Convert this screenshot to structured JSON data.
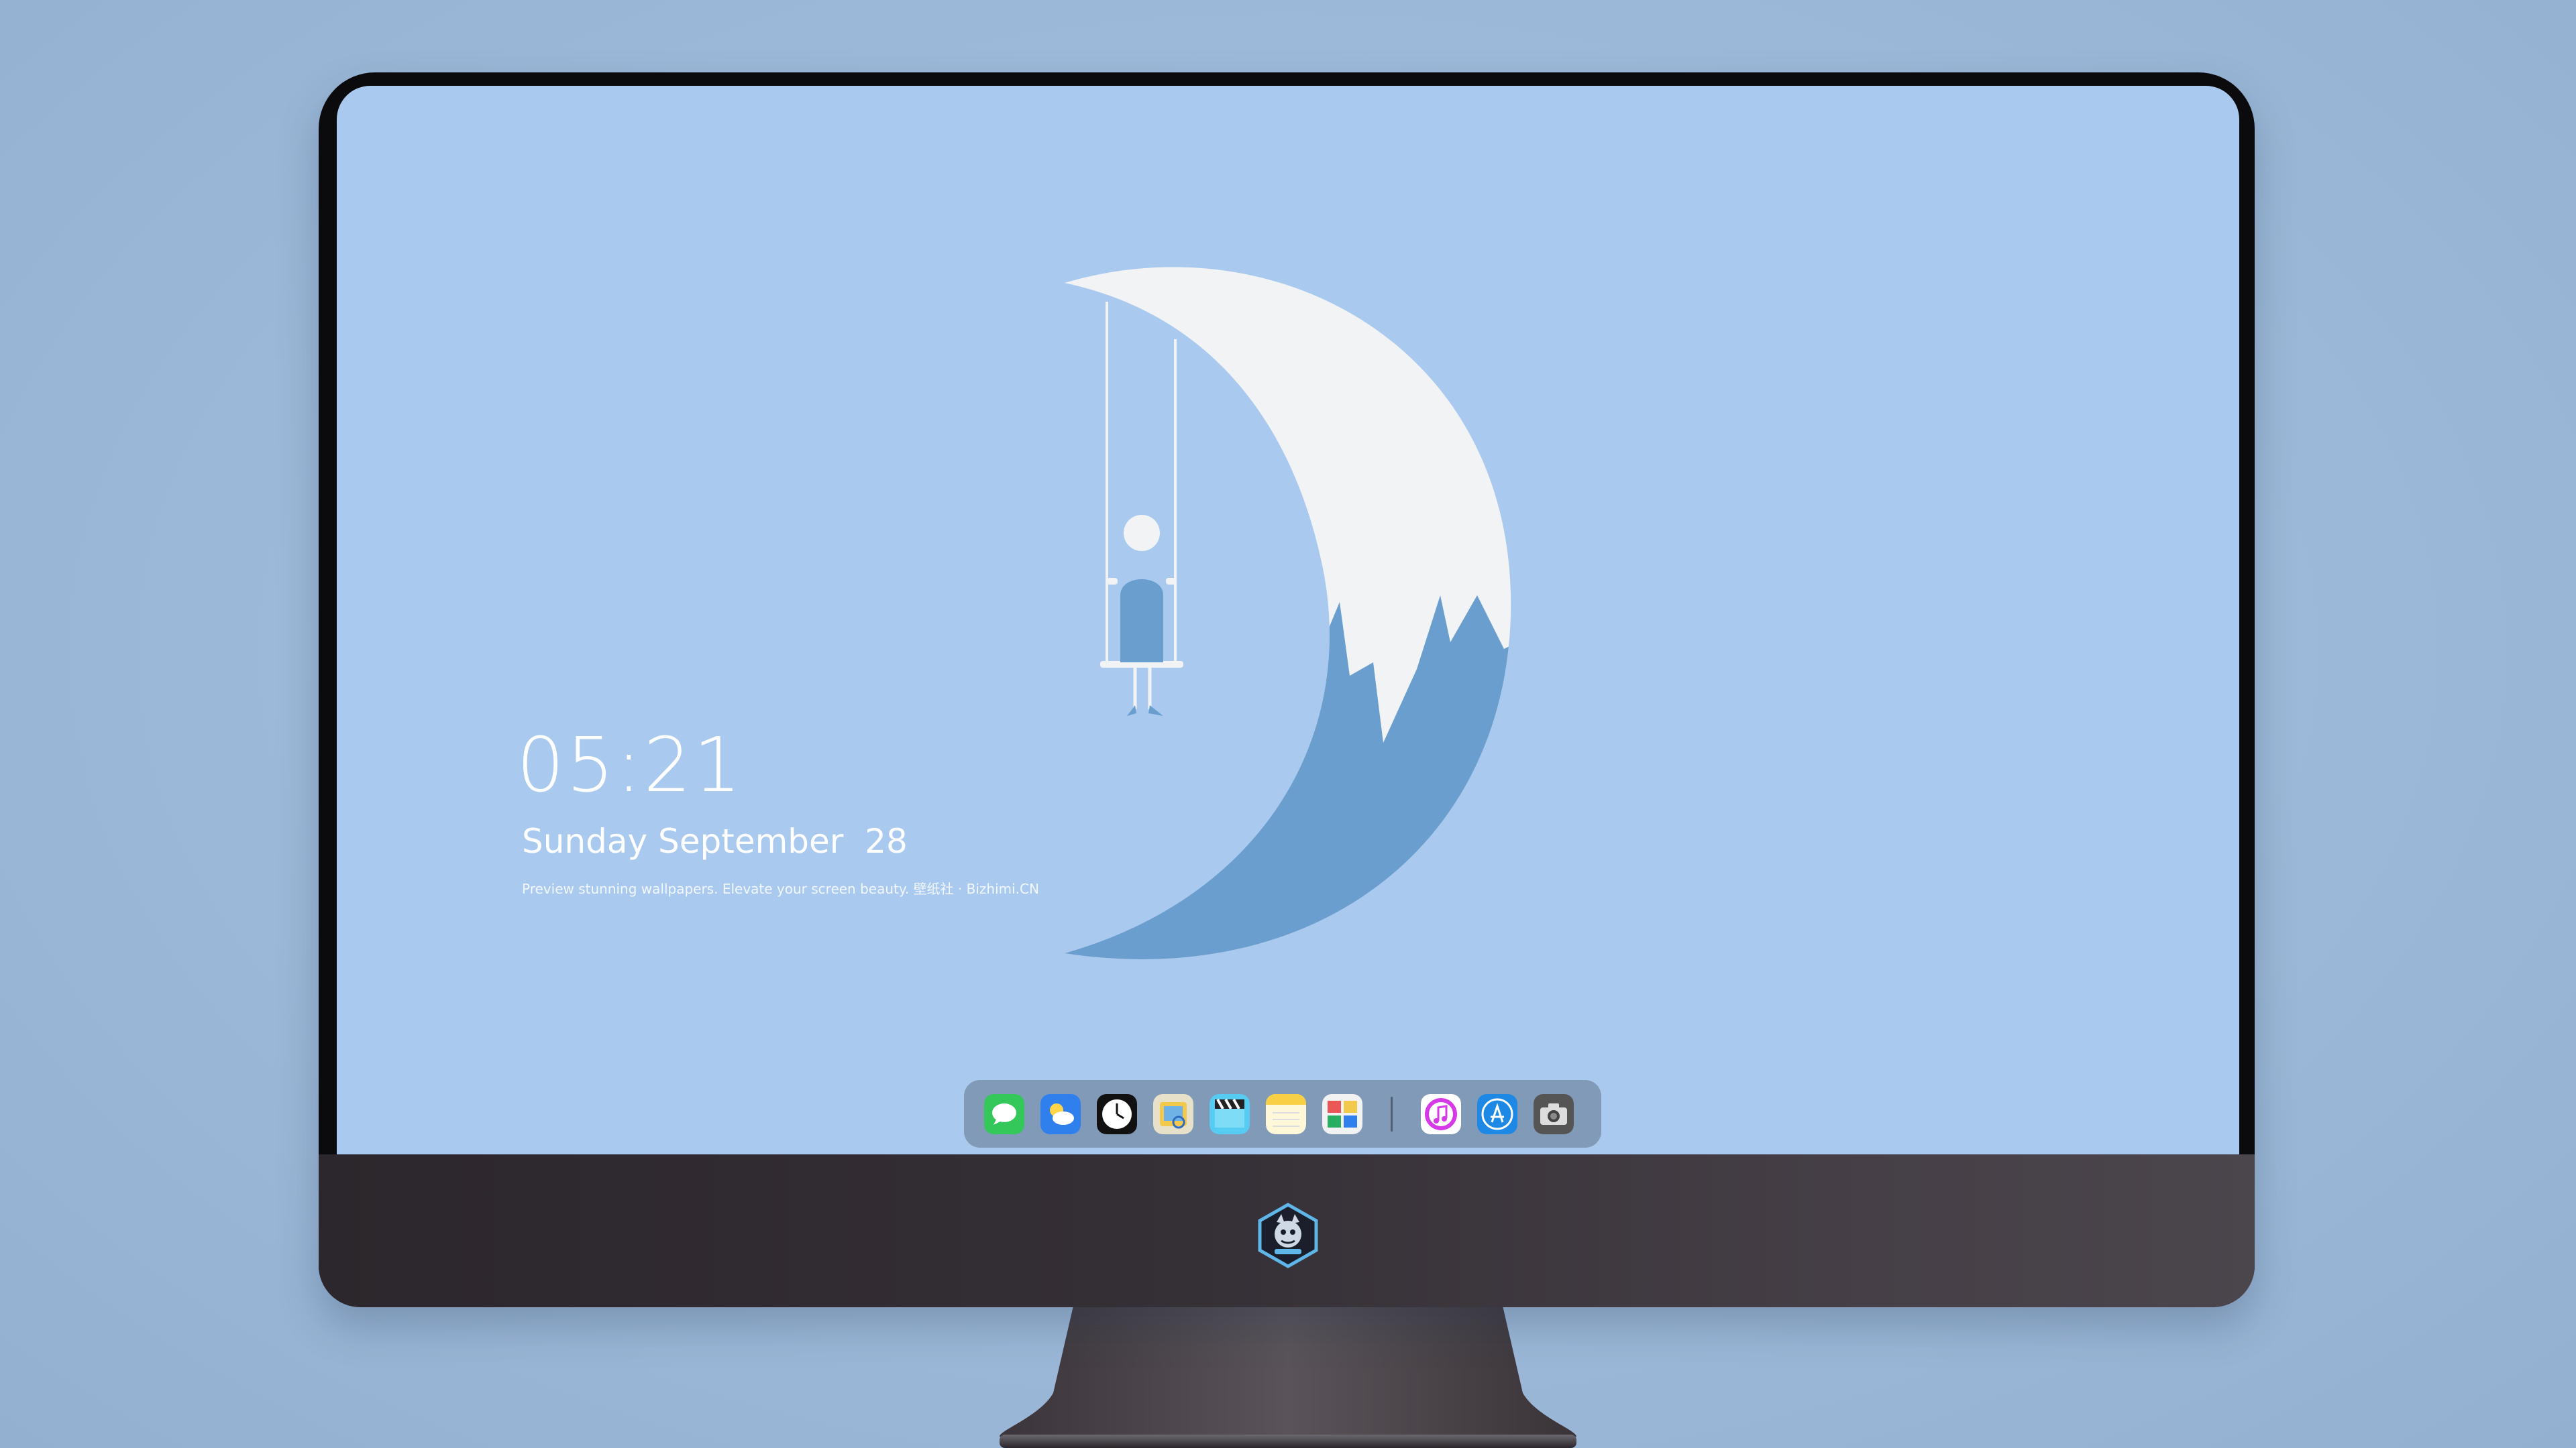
{
  "lock_screen": {
    "time": "05:21",
    "date": "Sunday September  28",
    "tagline": "Preview stunning wallpapers. Elevate your screen beauty. 壁纸社 · Bizhimi.CN"
  },
  "dock": {
    "apps": [
      {
        "name": "messages",
        "icon": "messages-icon",
        "color": "#34c759"
      },
      {
        "name": "weather",
        "icon": "weather-icon",
        "color": "#2f80ed"
      },
      {
        "name": "clock",
        "icon": "clock-icon",
        "color": "#111111"
      },
      {
        "name": "preview",
        "icon": "preview-icon",
        "color": "#f2c94c"
      },
      {
        "name": "clips",
        "icon": "clapperboard-icon",
        "color": "#56ccf2"
      },
      {
        "name": "notes",
        "icon": "notes-icon",
        "color": "#f7d046"
      },
      {
        "name": "photo-booth",
        "icon": "photo-booth-icon",
        "color": "#eb5757"
      },
      {
        "name": "itunes",
        "icon": "music-icon",
        "color": "#d63ae8"
      },
      {
        "name": "app-store",
        "icon": "app-store-icon",
        "color": "#1e88e5"
      },
      {
        "name": "camera",
        "icon": "camera-icon",
        "color": "#555555"
      }
    ]
  },
  "colors": {
    "background": "#9fbad8",
    "screen": "#a9caee",
    "moon_light": "#f2f3f5",
    "moon_dark": "#6a9ecf",
    "chin": "#352f36"
  }
}
